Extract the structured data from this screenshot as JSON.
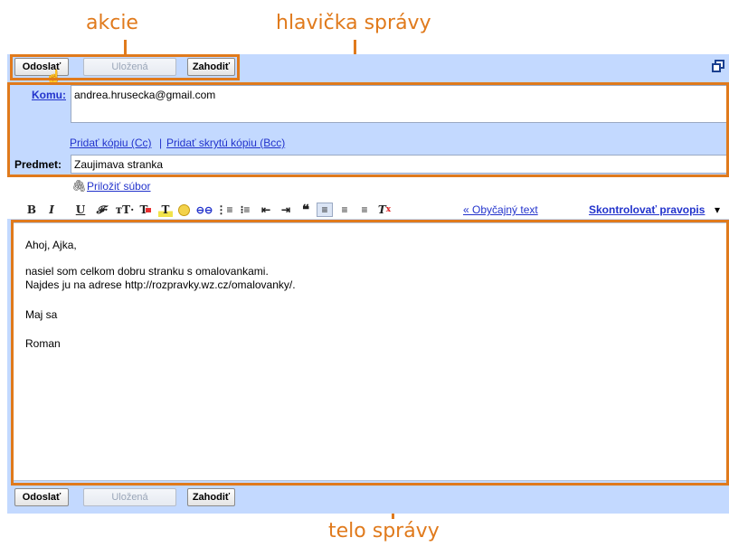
{
  "annotations": {
    "actions": "akcie",
    "header": "hlavička správy",
    "body": "telo správy"
  },
  "toolbar": {
    "send": "Odoslať",
    "saved": "Uložená",
    "discard": "Zahodiť"
  },
  "to": {
    "label": "Komu:",
    "value": "andrea.hrusecka@gmail.com"
  },
  "add_cc": "Pridať kópiu (Cc)",
  "separator": "|",
  "add_bcc": "Pridať skrytú kópiu (Bcc)",
  "subject": {
    "label": "Predmet:",
    "value": "Zaujimava stranka"
  },
  "attach": "Priložiť súbor",
  "format": {
    "plain_text": "« Obyčajný text",
    "spellcheck": "Skontrolovať pravopis",
    "spellcheck_arrow": "▾",
    "icons": [
      "bold",
      "italic",
      "underline",
      "font-family",
      "font-size",
      "text-color",
      "highlight",
      "emoticon",
      "link",
      "numbered-list",
      "bullet-list",
      "indent-less",
      "indent-more",
      "quote",
      "align-left",
      "align-center",
      "align-right",
      "remove-formatting"
    ]
  },
  "message_lines": [
    "Ahoj, Ajka,",
    "nasiel som celkom dobru stranku s omalovankami.",
    "Najdes ju na adrese http://rozpravky.wz.cz/omalovanky/.",
    "Maj sa",
    "Roman"
  ],
  "colors": {
    "annotation": "#e07a1c",
    "panel": "#c3d9ff",
    "link": "#2233cc"
  }
}
